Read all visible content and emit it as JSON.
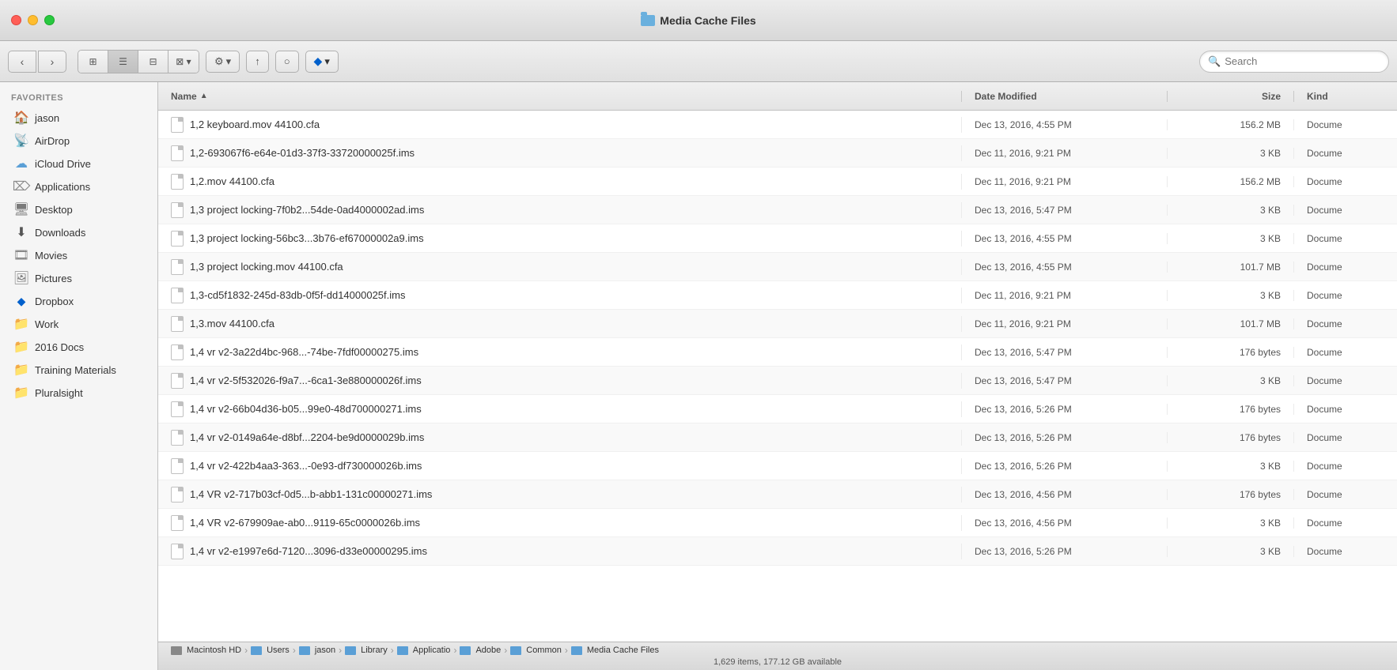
{
  "window": {
    "title": "Media Cache Files",
    "traffic_lights": [
      "close",
      "minimize",
      "maximize"
    ]
  },
  "toolbar": {
    "back_label": "‹",
    "forward_label": "›",
    "view_icons": [
      "⊞",
      "≡",
      "⊟",
      "⊠"
    ],
    "active_view": 1,
    "arrange_label": "⚙",
    "share_label": "↑",
    "tag_label": "○",
    "dropbox_label": "Dropbox",
    "search_placeholder": "Search"
  },
  "sidebar": {
    "section_label": "Favorites",
    "items": [
      {
        "id": "jason",
        "label": "jason",
        "icon": "🏠"
      },
      {
        "id": "airdrop",
        "label": "AirDrop",
        "icon": "📡"
      },
      {
        "id": "icloud",
        "label": "iCloud Drive",
        "icon": "☁"
      },
      {
        "id": "applications",
        "label": "Applications",
        "icon": "🔲"
      },
      {
        "id": "desktop",
        "label": "Desktop",
        "icon": "🖥"
      },
      {
        "id": "downloads",
        "label": "Downloads",
        "icon": "⬇"
      },
      {
        "id": "movies",
        "label": "Movies",
        "icon": "🎞"
      },
      {
        "id": "pictures",
        "label": "Pictures",
        "icon": "🖼"
      },
      {
        "id": "dropbox",
        "label": "Dropbox",
        "icon": "📦"
      },
      {
        "id": "work",
        "label": "Work",
        "icon": "📁"
      },
      {
        "id": "2016docs",
        "label": "2016 Docs",
        "icon": "📁"
      },
      {
        "id": "training",
        "label": "Training Materials",
        "icon": "📁"
      },
      {
        "id": "pluralsight",
        "label": "Pluralsight",
        "icon": "📁"
      }
    ]
  },
  "file_list": {
    "columns": {
      "name": "Name",
      "date_modified": "Date Modified",
      "size": "Size",
      "kind": "Kind"
    },
    "files": [
      {
        "name": "1,2 keyboard.mov 44100.cfa",
        "date": "Dec 13, 2016, 4:55 PM",
        "size": "156.2 MB",
        "kind": "Docume"
      },
      {
        "name": "1,2-693067f6-e64e-01d3-37f3-33720000025f.ims",
        "date": "Dec 11, 2016, 9:21 PM",
        "size": "3 KB",
        "kind": "Docume"
      },
      {
        "name": "1,2.mov 44100.cfa",
        "date": "Dec 11, 2016, 9:21 PM",
        "size": "156.2 MB",
        "kind": "Docume"
      },
      {
        "name": "1,3 project locking-7f0b2...54de-0ad4000002ad.ims",
        "date": "Dec 13, 2016, 5:47 PM",
        "size": "3 KB",
        "kind": "Docume"
      },
      {
        "name": "1,3 project locking-56bc3...3b76-ef67000002a9.ims",
        "date": "Dec 13, 2016, 4:55 PM",
        "size": "3 KB",
        "kind": "Docume"
      },
      {
        "name": "1,3 project locking.mov 44100.cfa",
        "date": "Dec 13, 2016, 4:55 PM",
        "size": "101.7 MB",
        "kind": "Docume"
      },
      {
        "name": "1,3-cd5f1832-245d-83db-0f5f-dd14000025f.ims",
        "date": "Dec 11, 2016, 9:21 PM",
        "size": "3 KB",
        "kind": "Docume"
      },
      {
        "name": "1,3.mov 44100.cfa",
        "date": "Dec 11, 2016, 9:21 PM",
        "size": "101.7 MB",
        "kind": "Docume"
      },
      {
        "name": "1,4 vr v2-3a22d4bc-968...-74be-7fdf00000275.ims",
        "date": "Dec 13, 2016, 5:47 PM",
        "size": "176 bytes",
        "kind": "Docume"
      },
      {
        "name": "1,4 vr v2-5f532026-f9a7...-6ca1-3e880000026f.ims",
        "date": "Dec 13, 2016, 5:47 PM",
        "size": "3 KB",
        "kind": "Docume"
      },
      {
        "name": "1,4 vr v2-66b04d36-b05...99e0-48d700000271.ims",
        "date": "Dec 13, 2016, 5:26 PM",
        "size": "176 bytes",
        "kind": "Docume"
      },
      {
        "name": "1,4 vr v2-0149a64e-d8bf...2204-be9d0000029b.ims",
        "date": "Dec 13, 2016, 5:26 PM",
        "size": "176 bytes",
        "kind": "Docume"
      },
      {
        "name": "1,4 vr v2-422b4aa3-363...-0e93-df730000026b.ims",
        "date": "Dec 13, 2016, 5:26 PM",
        "size": "3 KB",
        "kind": "Docume"
      },
      {
        "name": "1,4 VR v2-717b03cf-0d5...b-abb1-131c00000271.ims",
        "date": "Dec 13, 2016, 4:56 PM",
        "size": "176 bytes",
        "kind": "Docume"
      },
      {
        "name": "1,4 VR v2-679909ae-ab0...9119-65c0000026b.ims",
        "date": "Dec 13, 2016, 4:56 PM",
        "size": "3 KB",
        "kind": "Docume"
      },
      {
        "name": "1,4 vr v2-e1997e6d-7120...3096-d33e00000295.ims",
        "date": "Dec 13, 2016, 5:26 PM",
        "size": "3 KB",
        "kind": "Docume"
      }
    ]
  },
  "breadcrumb": {
    "items": [
      {
        "label": "Macintosh HD",
        "type": "hd"
      },
      {
        "label": "Users",
        "type": "folder"
      },
      {
        "label": "jason",
        "type": "home"
      },
      {
        "label": "Library",
        "type": "folder"
      },
      {
        "label": "Applicatio",
        "type": "folder"
      },
      {
        "label": "Adobe",
        "type": "folder"
      },
      {
        "label": "Common",
        "type": "folder"
      },
      {
        "label": "Media Cache Files",
        "type": "folder"
      }
    ]
  },
  "status": {
    "text": "1,629 items, 177.12 GB available"
  }
}
